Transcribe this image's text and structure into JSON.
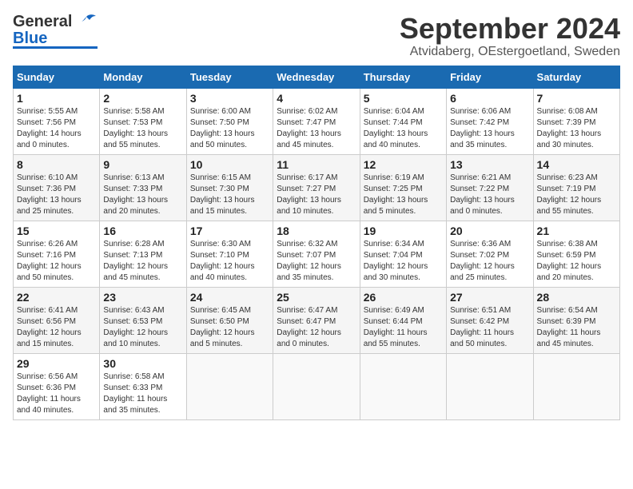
{
  "header": {
    "logo_general": "General",
    "logo_blue": "Blue",
    "month_title": "September 2024",
    "location": "Atvidaberg, OEstergoetland, Sweden"
  },
  "days_of_week": [
    "Sunday",
    "Monday",
    "Tuesday",
    "Wednesday",
    "Thursday",
    "Friday",
    "Saturday"
  ],
  "weeks": [
    [
      {
        "day": "1",
        "info": "Sunrise: 5:55 AM\nSunset: 7:56 PM\nDaylight: 14 hours\nand 0 minutes."
      },
      {
        "day": "2",
        "info": "Sunrise: 5:58 AM\nSunset: 7:53 PM\nDaylight: 13 hours\nand 55 minutes."
      },
      {
        "day": "3",
        "info": "Sunrise: 6:00 AM\nSunset: 7:50 PM\nDaylight: 13 hours\nand 50 minutes."
      },
      {
        "day": "4",
        "info": "Sunrise: 6:02 AM\nSunset: 7:47 PM\nDaylight: 13 hours\nand 45 minutes."
      },
      {
        "day": "5",
        "info": "Sunrise: 6:04 AM\nSunset: 7:44 PM\nDaylight: 13 hours\nand 40 minutes."
      },
      {
        "day": "6",
        "info": "Sunrise: 6:06 AM\nSunset: 7:42 PM\nDaylight: 13 hours\nand 35 minutes."
      },
      {
        "day": "7",
        "info": "Sunrise: 6:08 AM\nSunset: 7:39 PM\nDaylight: 13 hours\nand 30 minutes."
      }
    ],
    [
      {
        "day": "8",
        "info": "Sunrise: 6:10 AM\nSunset: 7:36 PM\nDaylight: 13 hours\nand 25 minutes."
      },
      {
        "day": "9",
        "info": "Sunrise: 6:13 AM\nSunset: 7:33 PM\nDaylight: 13 hours\nand 20 minutes."
      },
      {
        "day": "10",
        "info": "Sunrise: 6:15 AM\nSunset: 7:30 PM\nDaylight: 13 hours\nand 15 minutes."
      },
      {
        "day": "11",
        "info": "Sunrise: 6:17 AM\nSunset: 7:27 PM\nDaylight: 13 hours\nand 10 minutes."
      },
      {
        "day": "12",
        "info": "Sunrise: 6:19 AM\nSunset: 7:25 PM\nDaylight: 13 hours\nand 5 minutes."
      },
      {
        "day": "13",
        "info": "Sunrise: 6:21 AM\nSunset: 7:22 PM\nDaylight: 13 hours\nand 0 minutes."
      },
      {
        "day": "14",
        "info": "Sunrise: 6:23 AM\nSunset: 7:19 PM\nDaylight: 12 hours\nand 55 minutes."
      }
    ],
    [
      {
        "day": "15",
        "info": "Sunrise: 6:26 AM\nSunset: 7:16 PM\nDaylight: 12 hours\nand 50 minutes."
      },
      {
        "day": "16",
        "info": "Sunrise: 6:28 AM\nSunset: 7:13 PM\nDaylight: 12 hours\nand 45 minutes."
      },
      {
        "day": "17",
        "info": "Sunrise: 6:30 AM\nSunset: 7:10 PM\nDaylight: 12 hours\nand 40 minutes."
      },
      {
        "day": "18",
        "info": "Sunrise: 6:32 AM\nSunset: 7:07 PM\nDaylight: 12 hours\nand 35 minutes."
      },
      {
        "day": "19",
        "info": "Sunrise: 6:34 AM\nSunset: 7:04 PM\nDaylight: 12 hours\nand 30 minutes."
      },
      {
        "day": "20",
        "info": "Sunrise: 6:36 AM\nSunset: 7:02 PM\nDaylight: 12 hours\nand 25 minutes."
      },
      {
        "day": "21",
        "info": "Sunrise: 6:38 AM\nSunset: 6:59 PM\nDaylight: 12 hours\nand 20 minutes."
      }
    ],
    [
      {
        "day": "22",
        "info": "Sunrise: 6:41 AM\nSunset: 6:56 PM\nDaylight: 12 hours\nand 15 minutes."
      },
      {
        "day": "23",
        "info": "Sunrise: 6:43 AM\nSunset: 6:53 PM\nDaylight: 12 hours\nand 10 minutes."
      },
      {
        "day": "24",
        "info": "Sunrise: 6:45 AM\nSunset: 6:50 PM\nDaylight: 12 hours\nand 5 minutes."
      },
      {
        "day": "25",
        "info": "Sunrise: 6:47 AM\nSunset: 6:47 PM\nDaylight: 12 hours\nand 0 minutes."
      },
      {
        "day": "26",
        "info": "Sunrise: 6:49 AM\nSunset: 6:44 PM\nDaylight: 11 hours\nand 55 minutes."
      },
      {
        "day": "27",
        "info": "Sunrise: 6:51 AM\nSunset: 6:42 PM\nDaylight: 11 hours\nand 50 minutes."
      },
      {
        "day": "28",
        "info": "Sunrise: 6:54 AM\nSunset: 6:39 PM\nDaylight: 11 hours\nand 45 minutes."
      }
    ],
    [
      {
        "day": "29",
        "info": "Sunrise: 6:56 AM\nSunset: 6:36 PM\nDaylight: 11 hours\nand 40 minutes."
      },
      {
        "day": "30",
        "info": "Sunrise: 6:58 AM\nSunset: 6:33 PM\nDaylight: 11 hours\nand 35 minutes."
      },
      {
        "day": "",
        "info": ""
      },
      {
        "day": "",
        "info": ""
      },
      {
        "day": "",
        "info": ""
      },
      {
        "day": "",
        "info": ""
      },
      {
        "day": "",
        "info": ""
      }
    ]
  ]
}
